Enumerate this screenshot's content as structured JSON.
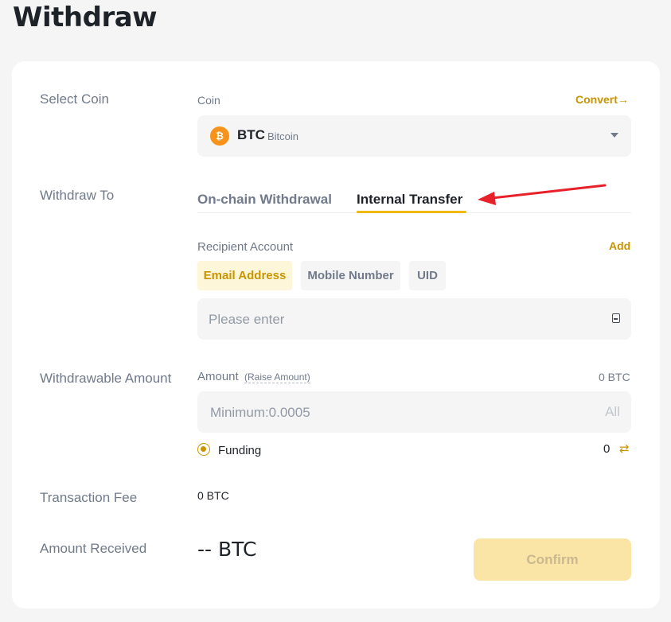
{
  "page": {
    "title": "Withdraw"
  },
  "select_coin": {
    "label": "Select Coin",
    "field_label": "Coin",
    "convert_link": "Convert",
    "convert_arrow": "→",
    "selected": {
      "icon_glyph": "₿",
      "symbol": "BTC",
      "name": "Bitcoin"
    }
  },
  "withdraw_to": {
    "label": "Withdraw To",
    "tabs": [
      {
        "label": "On-chain Withdrawal",
        "active": false
      },
      {
        "label": "Internal Transfer",
        "active": true
      }
    ]
  },
  "recipient": {
    "label": "Recipient Account",
    "add_link": "Add",
    "types": [
      {
        "label": "Email Address",
        "active": true
      },
      {
        "label": "Mobile Number",
        "active": false
      },
      {
        "label": "UID",
        "active": false
      }
    ],
    "input_placeholder": "Please enter"
  },
  "withdrawable": {
    "label": "Withdrawable Amount",
    "amount_label": "Amount",
    "raise_link": "(Raise Amount)",
    "balance": "0 BTC",
    "input_placeholder": "Minimum:0.0005",
    "all_button": "All",
    "account_option": "Funding",
    "account_balance": "0",
    "swap_glyph": "⇄"
  },
  "fee": {
    "label": "Transaction Fee",
    "value": "0 BTC"
  },
  "received": {
    "label": "Amount Received",
    "value": "-- BTC",
    "confirm_button": "Confirm"
  },
  "colors": {
    "accent": "#c99400",
    "brand_yellow": "#f0b90b",
    "annotation_arrow": "#e8202a",
    "btc_orange": "#f7931a"
  },
  "icons": [
    "bitcoin-icon",
    "chevron-down-icon",
    "arrow-right-icon",
    "paste-icon",
    "radio-selected-icon",
    "swap-icon",
    "annotation-arrow-icon"
  ]
}
